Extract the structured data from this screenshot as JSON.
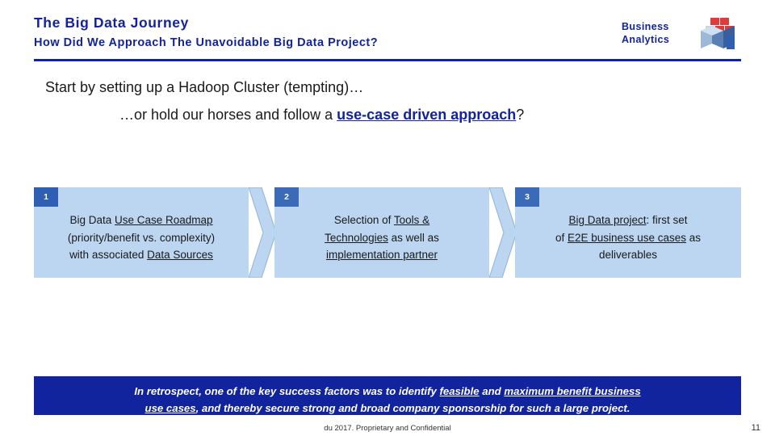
{
  "header": {
    "title": "The Big Data Journey",
    "subtitle": "How Did We Approach The Unavoidable Big Data Project?",
    "brand_line1": "Business",
    "brand_line2": "Analytics",
    "rule_color": "#12239e",
    "title_color": "#12239e"
  },
  "intro": {
    "line1": "Start by setting up a Hadoop Cluster (tempting)…",
    "line2_prefix": "…or hold our horses and follow a ",
    "line2_emphasis": "use-case driven approach",
    "line2_suffix": "?"
  },
  "steps": [
    {
      "number": "1",
      "seg1": "Big Data ",
      "seg2_underline": "Use Case Roadmap",
      "seg3": "(priority/benefit vs. complexity)",
      "seg4": "with associated ",
      "seg5_underline": "Data Sources"
    },
    {
      "number": "2",
      "seg1": "Selection of ",
      "seg2_underline": "Tools &",
      "seg3_underline": "Technologies",
      "seg4": " as well as",
      "seg5_underline": "implementation partner"
    },
    {
      "number": "3",
      "seg1_underline": "Big Data project",
      "seg2": ": first set",
      "seg3": "of ",
      "seg4_underline": "E2E business use cases",
      "seg5": " as",
      "seg6": "deliverables"
    }
  ],
  "callout": {
    "seg1": "In retrospect, one of the key success factors was to identify ",
    "seg2_underline": "feasible",
    "seg3": " and ",
    "seg4_underline": "maximum benefit business",
    "seg5": "use cases",
    "seg6": ", and thereby secure strong and broad company sponsorship for such a large project.",
    "background": "#12239e",
    "text_color": "#ffffff"
  },
  "footer": {
    "note": "du 2017. Proprietary and Confidential",
    "page_number": "11"
  },
  "colors": {
    "step_block": "#bcd5f0",
    "badge": "#2f5fb3",
    "accent_blue": "#12239e"
  }
}
